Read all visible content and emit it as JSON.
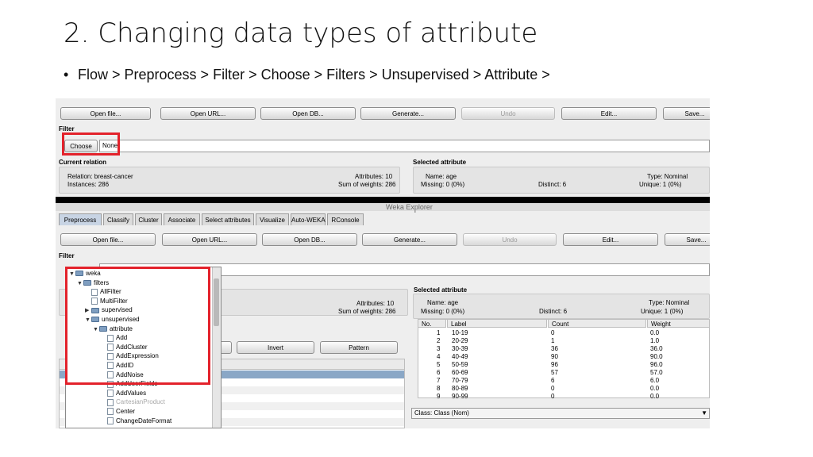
{
  "slide": {
    "title": "2. Changing data types of attribute",
    "bullet": "Flow > Preprocess > Filter > Choose > Filters > Unsupervised > Attribute >"
  },
  "top": {
    "buttons": [
      "Open file...",
      "Open URL...",
      "Open DB...",
      "Generate...",
      "Undo",
      "Edit...",
      "Save..."
    ],
    "filter_label": "Filter",
    "choose_label": "Choose",
    "filter_value": "None",
    "current_relation_label": "Current relation",
    "relation": "Relation: breast-cancer",
    "instances": "Instances: 286",
    "attributes": "Attributes: 10",
    "sum_weights": "Sum of weights: 286",
    "selected_attribute_label": "Selected attribute",
    "name": "Name: age",
    "missing": "Missing: 0 (0%)",
    "distinct": "Distinct: 6",
    "type": "Type: Nominal",
    "unique": "Unique: 1 (0%)",
    "partial_cols": [
      "No.",
      "Label",
      "Count",
      "Weight"
    ]
  },
  "explorer": {
    "window_title": "Weka Explorer",
    "tabs": [
      "Preprocess",
      "Classify",
      "Cluster",
      "Associate",
      "Select attributes",
      "Visualize",
      "Auto-WEKA",
      "RConsole"
    ],
    "buttons": [
      "Open file...",
      "Open URL...",
      "Open DB...",
      "Generate...",
      "Undo",
      "Edit...",
      "Save..."
    ],
    "filter_label": "Filter",
    "attributes": "Attributes: 10",
    "sum_weights": "Sum of weights: 286",
    "invert_button": "Invert",
    "pattern_button": "Pattern",
    "selected_attribute_label": "Selected attribute",
    "name": "Name: age",
    "missing": "Missing: 0 (0%)",
    "distinct": "Distinct: 6",
    "type": "Type: Nominal",
    "unique": "Unique: 1 (0%)",
    "table": {
      "columns": [
        "No.",
        "Label",
        "Count",
        "Weight"
      ],
      "rows": [
        [
          "1",
          "10-19",
          "0",
          "0.0"
        ],
        [
          "2",
          "20-29",
          "1",
          "1.0"
        ],
        [
          "3",
          "30-39",
          "36",
          "36.0"
        ],
        [
          "4",
          "40-49",
          "90",
          "90.0"
        ],
        [
          "5",
          "50-59",
          "96",
          "96.0"
        ],
        [
          "6",
          "60-69",
          "57",
          "57.0"
        ],
        [
          "7",
          "70-79",
          "6",
          "6.0"
        ],
        [
          "8",
          "80-89",
          "0",
          "0.0"
        ],
        [
          "9",
          "90-99",
          "0",
          "0.0"
        ]
      ]
    },
    "class_select": "Class: Class (Nom)",
    "tree": [
      {
        "label": "weka",
        "type": "folder",
        "depth": 0,
        "expanded": true
      },
      {
        "label": "filters",
        "type": "folder",
        "depth": 1,
        "expanded": true
      },
      {
        "label": "AllFilter",
        "type": "file",
        "depth": 2
      },
      {
        "label": "MultiFilter",
        "type": "file",
        "depth": 2
      },
      {
        "label": "supervised",
        "type": "folder",
        "depth": 2,
        "expanded": false
      },
      {
        "label": "unsupervised",
        "type": "folder",
        "depth": 2,
        "expanded": true
      },
      {
        "label": "attribute",
        "type": "folder",
        "depth": 3,
        "expanded": true
      },
      {
        "label": "Add",
        "type": "file",
        "depth": 4
      },
      {
        "label": "AddCluster",
        "type": "file",
        "depth": 4
      },
      {
        "label": "AddExpression",
        "type": "file",
        "depth": 4
      },
      {
        "label": "AddID",
        "type": "file",
        "depth": 4
      },
      {
        "label": "AddNoise",
        "type": "file",
        "depth": 4
      },
      {
        "label": "AddUserFields",
        "type": "file",
        "depth": 4
      },
      {
        "label": "AddValues",
        "type": "file",
        "depth": 4
      },
      {
        "label": "CartesianProduct",
        "type": "file",
        "depth": 4,
        "disabled": true
      },
      {
        "label": "Center",
        "type": "file",
        "depth": 4
      },
      {
        "label": "ChangeDateFormat",
        "type": "file",
        "depth": 4
      }
    ]
  },
  "colors": {
    "highlight": "#e3222b",
    "tab_active": "#c8d4e4",
    "selected_row": "#8aa7c6"
  }
}
